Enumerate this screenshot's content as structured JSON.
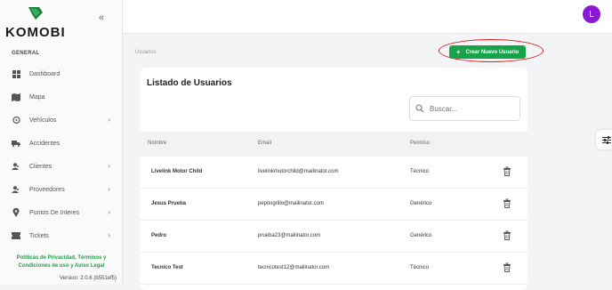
{
  "brand": {
    "name": "KOMOBI",
    "accent": "#16a34a",
    "collapse_icon": "double-chevron-left-icon"
  },
  "sidebar": {
    "section": "GENERAL",
    "items": [
      {
        "label": "Dashboard",
        "icon": "dashboard-icon",
        "has_chevron": false
      },
      {
        "label": "Mapa",
        "icon": "map-icon",
        "has_chevron": false
      },
      {
        "label": "Vehículos",
        "icon": "vehicle-icon",
        "has_chevron": true
      },
      {
        "label": "Accidentes",
        "icon": "truck-icon",
        "has_chevron": false
      },
      {
        "label": "Clientes",
        "icon": "users-icon",
        "has_chevron": true
      },
      {
        "label": "Proveedores",
        "icon": "users-icon",
        "has_chevron": true
      },
      {
        "label": "Puntos De Interes",
        "icon": "location-pin-icon",
        "has_chevron": true
      },
      {
        "label": "Tickets",
        "icon": "ticket-icon",
        "has_chevron": true
      }
    ],
    "footer_links": "Políticas de Privacidad, Términos y Condiciones de uso y Aviso Legal",
    "version": "Version: 2.0.6 (b551ef5)"
  },
  "topbar": {
    "avatar_initial": "L",
    "avatar_color": "#8a18d6"
  },
  "breadcrumb": "Usuarios",
  "create_button": {
    "label": "Crear Nuevo Usuario",
    "icon": "plus-icon"
  },
  "users_card": {
    "title": "Listado de Usuarios",
    "search_placeholder": "Buscar...",
    "columns": [
      "Nombre",
      "Email",
      "Permiso"
    ],
    "rows": [
      {
        "name": "Livelink Motor Child",
        "email": "livelinkmotorchild@mailinator.com",
        "permiso": "Técnico"
      },
      {
        "name": "Jesus Prueba",
        "email": "pepitogrillo@mailinator.com",
        "permiso": "Genérico"
      },
      {
        "name": "Pedro",
        "email": "prueba23@mailinator.com",
        "permiso": "Genérico"
      },
      {
        "name": "Tecnico Test",
        "email": "tecnicotest12@mailinator.com",
        "permiso": "Técnico"
      }
    ]
  },
  "filter_tab_icon": "sliders-icon"
}
